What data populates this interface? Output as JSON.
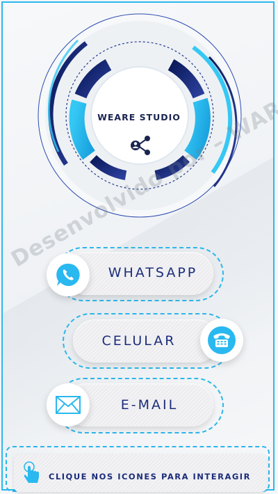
{
  "brand": {
    "title": "WEARE STUDIO",
    "icon": "share-network-icon"
  },
  "watermark": "Desenvolvido por – WAREST",
  "buttons": [
    {
      "id": "whatsapp",
      "label": "WHATSAPP",
      "icon": "whatsapp-phone-icon",
      "icon_color": "#29b8ef"
    },
    {
      "id": "celular",
      "label": "CELULAR",
      "icon": "telephone-icon",
      "icon_color": "#29b8ef"
    },
    {
      "id": "email",
      "label": "E-MAIL",
      "icon": "envelope-icon",
      "icon_color": "#29b8ef"
    }
  ],
  "footer": {
    "text": "CLIQUE NOS ICONES PARA INTERAGIR",
    "icon": "tap-hand-icon"
  },
  "colors": {
    "accent": "#29b8ef",
    "navy": "#1c2d7a",
    "dark_navy": "#1a2550"
  }
}
